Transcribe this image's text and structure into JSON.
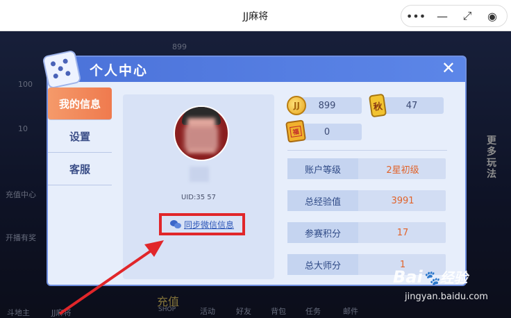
{
  "window": {
    "title": "JJ麻将",
    "controls": [
      {
        "name": "more-icon",
        "glyph": "•••"
      },
      {
        "name": "minimize-icon",
        "glyph": "—"
      },
      {
        "name": "restore-icon",
        "glyph": "⤢"
      },
      {
        "name": "close-target-icon",
        "glyph": "◉"
      }
    ]
  },
  "background": {
    "items": [
      "899",
      "100",
      "10",
      "充值中心",
      "开播有奖",
      "斗地主",
      "JJ麻将",
      "充值",
      "SHOP",
      "活动",
      "好友",
      "背包",
      "任务",
      "邮件",
      "更多玩法"
    ]
  },
  "dialog": {
    "title": "个人中心",
    "close_glyph": "✕",
    "tabs": [
      "我的信息",
      "设置",
      "客服"
    ],
    "active_tab": 0,
    "profile": {
      "uid": "UID:35          57",
      "sync_label": "同步微信信息"
    },
    "resources": [
      {
        "icon": "gold-coin-icon",
        "glyph": "JJ",
        "value": "899"
      },
      {
        "icon": "qiu-card-icon",
        "glyph": "秋",
        "value": "47"
      },
      {
        "icon": "ticket-icon",
        "glyph": "福",
        "value": "0"
      }
    ],
    "stats": [
      {
        "label": "账户等级",
        "value": "2星初级"
      },
      {
        "label": "总经验值",
        "value": "3991"
      },
      {
        "label": "参赛积分",
        "value": "17"
      },
      {
        "label": "总大师分",
        "value": "1"
      }
    ]
  },
  "watermark": {
    "brand": "Bai",
    "brand2": "经验",
    "url": "jingyan.baidu.com"
  },
  "colors": {
    "accent_blue": "#4b72d9",
    "active_tab": "#ef7a4e",
    "value_orange": "#e1632a",
    "highlight_red": "#e1262a"
  }
}
